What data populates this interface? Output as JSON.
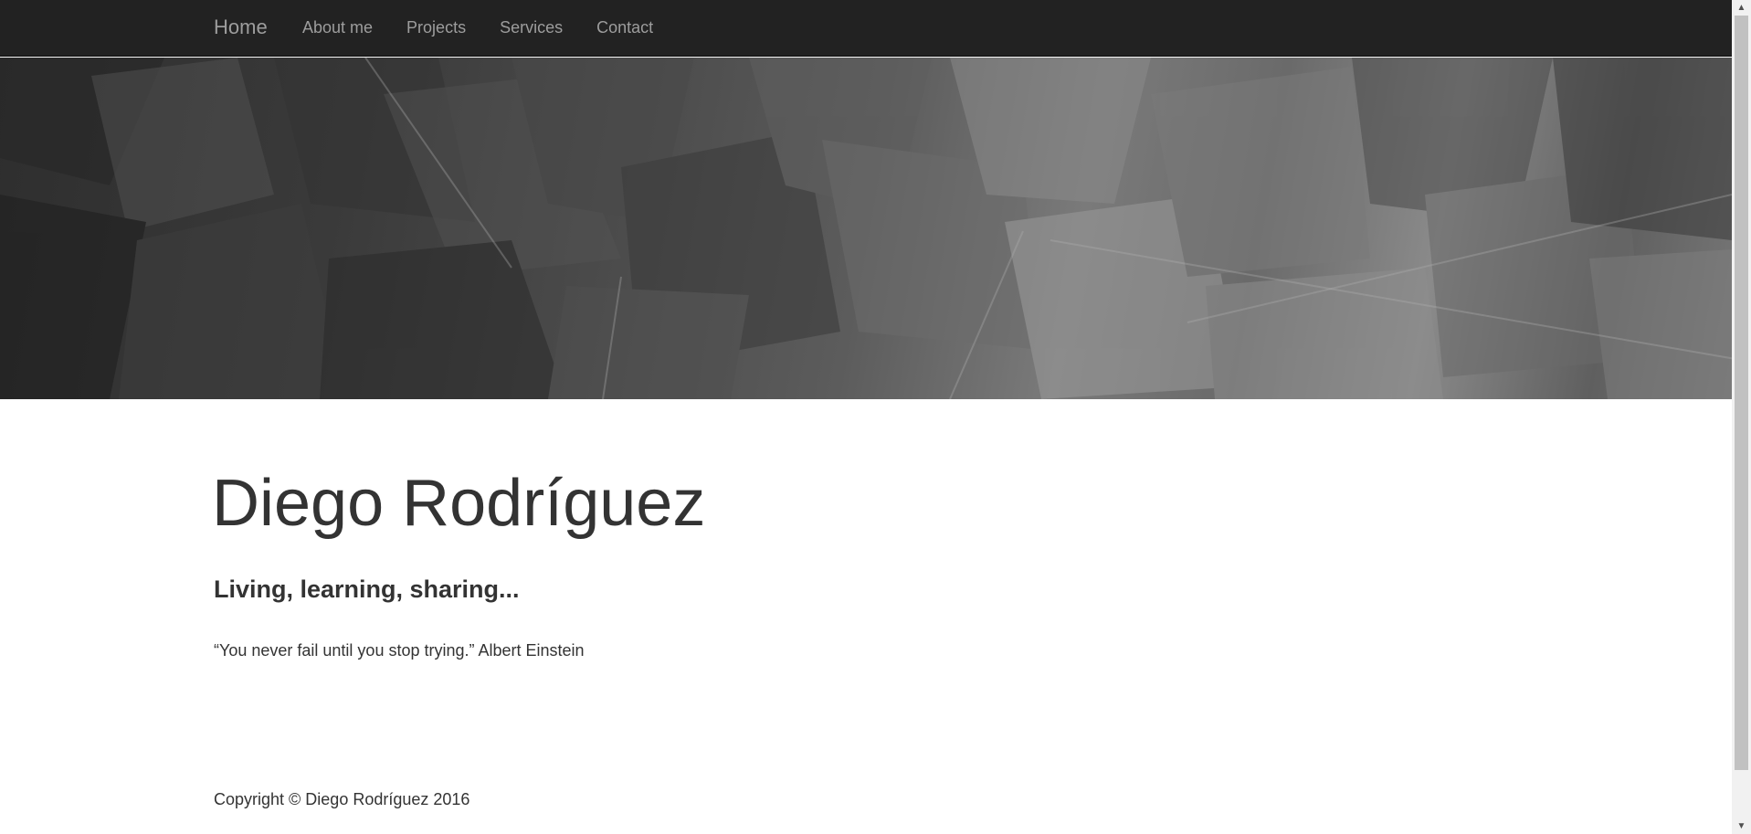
{
  "nav": {
    "brand": "Home",
    "links": [
      "About me",
      "Projects",
      "Services",
      "Contact"
    ]
  },
  "content": {
    "title": "Diego Rodríguez",
    "subtitle": "Living, learning, sharing...",
    "quote": "“You never fail until you stop trying.” Albert Einstein"
  },
  "footer": {
    "copyright": "Copyright © Diego Rodríguez 2016"
  },
  "icons": {
    "scroll_up": "chevron-up-icon",
    "scroll_down": "chevron-down-icon"
  },
  "colors": {
    "navbar_bg": "#222222",
    "nav_text": "#9d9d9d",
    "body_text": "#333333"
  }
}
